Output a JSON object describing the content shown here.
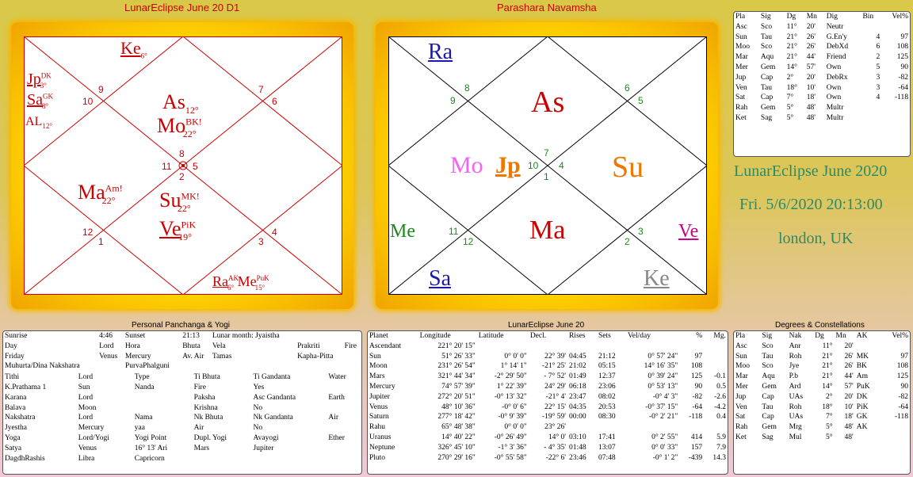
{
  "titles": {
    "d1": "LunarEclipse June 20 D1",
    "navamsha": "Parashara Navamsha",
    "panchanga": "Personal Panchanga & Yogi",
    "positions": "LunarEclipse June 20",
    "degrees": "Degrees & Constellations"
  },
  "event": {
    "name": "LunarEclipse June 2020",
    "datetime": "Fri. 5/6/2020  20:13:00",
    "place": "london, UK"
  },
  "colors": {
    "accent_red": "#cc0000",
    "event_text": "#2a8a6a",
    "chart_frame": "#ffd400"
  },
  "d1_chart": {
    "ke": {
      "name": "Ke",
      "deg": "6°"
    },
    "jp": {
      "name": "Jp",
      "tag": "DK",
      "deg": "3°"
    },
    "sa": {
      "name": "Sa",
      "tag": "GK",
      "deg": "8°"
    },
    "al": {
      "name": "AL",
      "deg": "12°"
    },
    "as": {
      "name": "As",
      "deg": "12°"
    },
    "mo": {
      "name": "Mo",
      "tag": "BK!",
      "deg": "22°"
    },
    "ma": {
      "name": "Ma",
      "tag": "Am!",
      "deg": "22°"
    },
    "su": {
      "name": "Su",
      "tag": "MK!",
      "deg": "22°"
    },
    "ve": {
      "name": "Ve",
      "tag": "PiK",
      "deg": "19°"
    },
    "ra": {
      "name": "Ra",
      "tag": "AK",
      "deg": "6°"
    },
    "me": {
      "name": "Me",
      "tag": "PuK",
      "deg": "15°"
    },
    "houses": [
      "9",
      "10",
      "7",
      "6",
      "8",
      "11",
      "5",
      "2",
      "12",
      "1",
      "3",
      "4"
    ]
  },
  "navamsha_chart": {
    "planets": [
      "Ra",
      "As",
      "Mo",
      "Jp",
      "Su",
      "Me",
      "Ma",
      "Ve",
      "Sa",
      "Ke"
    ],
    "houses": [
      "9",
      "8",
      "6",
      "5",
      "7",
      "10",
      "4",
      "1",
      "11",
      "12",
      "2",
      "3"
    ]
  },
  "right_table": {
    "headers": [
      "Pla",
      "Sig",
      "Dg",
      "Mn",
      "Dig",
      "Bin",
      "Vel%"
    ],
    "rows": [
      [
        "Asc",
        "Sco",
        "11°",
        "20'",
        "Neutr",
        "",
        ""
      ],
      [
        "Sun",
        "Tau",
        "21°",
        "26'",
        "G.En'y",
        "4",
        "97"
      ],
      [
        "Moo",
        "Sco",
        "21°",
        "26'",
        "DebXd",
        "6",
        "108"
      ],
      [
        "Mar",
        "Aqu",
        "21°",
        "44'",
        "Friend",
        "2",
        "125"
      ],
      [
        "Mer",
        "Gem",
        "14°",
        "57'",
        "Own",
        "5",
        "90"
      ],
      [
        "Jup",
        "Cap",
        "2°",
        "20'",
        "DebRx",
        "3",
        "-82"
      ],
      [
        "Ven",
        "Tau",
        "18°",
        "10'",
        "Own",
        "3",
        "-64"
      ],
      [
        "Sat",
        "Cap",
        "7°",
        "18'",
        "Own",
        "4",
        "-118"
      ],
      [
        "Rah",
        "Gem",
        "5°",
        "48'",
        "Multr",
        "",
        ""
      ],
      [
        "Ket",
        "Sag",
        "5°",
        "48'",
        "Multr",
        "",
        ""
      ]
    ]
  },
  "panchanga": {
    "top": [
      [
        "Sunrise",
        "4:46",
        "Sunset",
        "21:13",
        "Lunar month: Jyaistha",
        "",
        ""
      ],
      [
        "Day",
        "Lord",
        "Hora",
        "Bhuta",
        "Vela",
        "Prakriti",
        "Fire"
      ],
      [
        "Friday",
        "Venus",
        "Mercury",
        "Av. Air",
        "Tamas",
        "Kapha-Pitta",
        ""
      ],
      [
        "Muhurta/Dina Nakshatra",
        "",
        "PurvaPhalguni",
        "",
        "",
        "",
        ""
      ]
    ],
    "rows": [
      [
        "Tithi",
        "Lord",
        "Type",
        "Ti Bhuta",
        "Ti Gandanta",
        "Water"
      ],
      [
        "K.Prathama 1",
        "Sun",
        "Nanda",
        "Fire",
        "Yes",
        ""
      ],
      [
        "Karana",
        "Lord",
        "",
        "Paksha",
        "Asc Gandanta",
        "Earth"
      ],
      [
        "Balava",
        "Moon",
        "",
        "Krishna",
        "No",
        ""
      ],
      [
        "Nakshatra",
        "Lord",
        "Nama",
        "Nk Bhuta",
        "Nk Gandanta",
        "Air"
      ],
      [
        "Jyestha",
        "Mercury",
        "yaa",
        "Air",
        "No",
        ""
      ],
      [
        "Yoga",
        "Lord/Yogi",
        "Yogi Point",
        "Dupl. Yogi",
        "Avayogi",
        "Ether"
      ],
      [
        "Satya",
        "Venus",
        "16° 13' Ari",
        "Mars",
        "Jupiter",
        ""
      ],
      [
        "DagdhRashis",
        "Libra",
        "Capricorn",
        "",
        "",
        ""
      ]
    ]
  },
  "positions": {
    "headers": [
      "Planet",
      "Longitude",
      "Latitude",
      "Decl.",
      "Rises",
      "Sets",
      "Vel/day",
      "%",
      "Mg."
    ],
    "rows": [
      [
        "Ascendant",
        "221° 20' 15\"",
        "",
        "",
        "",
        "",
        "",
        "",
        ""
      ],
      [
        "Sun",
        "51° 26' 33\"",
        "0°  0'  0\"",
        "22° 39'",
        "04:45",
        "21:12",
        "0° 57' 24\"",
        "97",
        ""
      ],
      [
        "Moon",
        "231° 26' 54\"",
        "1° 14'  1\"",
        "-21° 25'",
        "21:02",
        "05:15",
        "14° 16' 35\"",
        "108",
        ""
      ],
      [
        "Mars",
        "321° 44' 34\"",
        "-2° 29' 50\"",
        "- 7° 52'",
        "01:49",
        "12:37",
        "0° 39' 24\"",
        "125",
        "-0.1"
      ],
      [
        "Mercury",
        "74° 57' 39\"",
        "1° 22' 39\"",
        "24° 29'",
        "06:18",
        "23:06",
        "0° 53' 13\"",
        "90",
        "0.5"
      ],
      [
        "Jupiter",
        "272° 20' 51\"",
        "-0° 13' 32\"",
        "-21° 4'",
        "23:47",
        "08:02",
        "-0°  4'  3\"",
        "-82",
        "-2.6"
      ],
      [
        "Venus",
        "48° 10' 36\"",
        "-0°  0'  6\"",
        "22° 15'",
        "04:35",
        "20:53",
        "-0° 37' 15\"",
        "-64",
        "-4.2"
      ],
      [
        "Saturn",
        "277° 18' 42\"",
        "-0°  9' 39\"",
        "-19° 59'",
        "00:00",
        "08:30",
        "-0°  2' 21\"",
        "-118",
        "0.4"
      ],
      [
        "Rahu",
        "65° 48' 38\"",
        "0°  0'  0\"",
        "23° 26'",
        "",
        "",
        "",
        "",
        ""
      ],
      [
        "Uranus",
        "14° 40' 22\"",
        "-0° 26' 49\"",
        "14°  0'",
        "03:10",
        "17:41",
        "0°  2' 55\"",
        "414",
        "5.9"
      ],
      [
        "Neptune",
        "326° 45' 10\"",
        "-1°  3' 36\"",
        "- 4° 35'",
        "01:48",
        "13:07",
        "0°  0' 33\"",
        "157",
        "7.9"
      ],
      [
        "Pluto",
        "270° 29' 16\"",
        "-0° 55' 58\"",
        "-22°  6'",
        "23:46",
        "07:48",
        "-0°  1'  2\"",
        "-439",
        "14.3"
      ]
    ]
  },
  "degrees": {
    "headers": [
      "Pla",
      "Sig",
      "Nak",
      "Dg",
      "Mn",
      "AK",
      "Vel%"
    ],
    "rows": [
      [
        "Asc",
        "Sco",
        "Anr",
        "11°",
        "20'",
        "",
        ""
      ],
      [
        "Sun",
        "Tau",
        "Roh",
        "21°",
        "26'",
        "MK",
        "97"
      ],
      [
        "Moo",
        "Sco",
        "Jye",
        "21°",
        "26'",
        "BK",
        "108"
      ],
      [
        "Mar",
        "Aqu",
        "P.b",
        "21°",
        "44'",
        "Am",
        "125"
      ],
      [
        "Mer",
        "Gem",
        "Ard",
        "14°",
        "57'",
        "PuK",
        "90"
      ],
      [
        "Jup",
        "Cap",
        "UAs",
        "2°",
        "20'",
        "DK",
        "-82"
      ],
      [
        "Ven",
        "Tau",
        "Roh",
        "18°",
        "10'",
        "PiK",
        "-64"
      ],
      [
        "Sat",
        "Cap",
        "UAs",
        "7°",
        "18'",
        "GK",
        "-118"
      ],
      [
        "Rah",
        "Gem",
        "Mrg",
        "5°",
        "48'",
        "AK",
        ""
      ],
      [
        "Ket",
        "Sag",
        "Mul",
        "5°",
        "48'",
        "",
        ""
      ]
    ]
  }
}
